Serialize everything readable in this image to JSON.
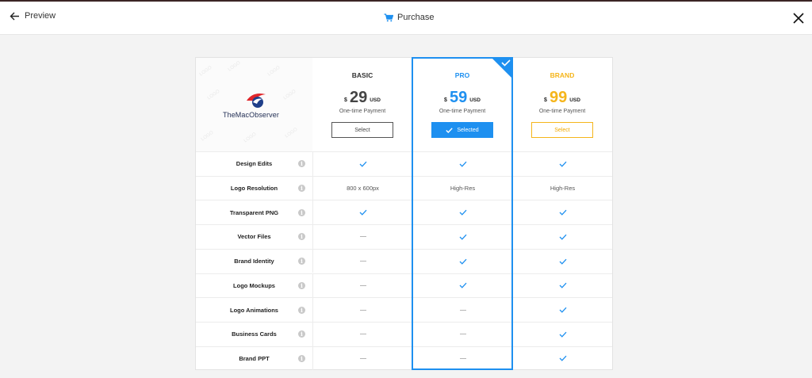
{
  "header": {
    "back_label": "Preview",
    "title": "Purchase"
  },
  "logo": {
    "text": "TheMacObserver"
  },
  "plans": [
    {
      "name": "BASIC",
      "currency": "$",
      "amount": "29",
      "unit": "USD",
      "payment": "One-time Payment",
      "button": "Select",
      "color": "#444444"
    },
    {
      "name": "PRO",
      "currency": "$",
      "amount": "59",
      "unit": "USD",
      "payment": "One-time Payment",
      "button": "Selected",
      "color": "#1e90f0"
    },
    {
      "name": "BRAND",
      "currency": "$",
      "amount": "99",
      "unit": "USD",
      "payment": "One-time Payment",
      "button": "Select",
      "color": "#f5b51b"
    }
  ],
  "features": [
    {
      "name": "Design Edits",
      "values": [
        "check",
        "check",
        "check"
      ]
    },
    {
      "name": "Logo Resolution",
      "values": [
        "800 x 600px",
        "High-Res",
        "High-Res"
      ]
    },
    {
      "name": "Transparent PNG",
      "values": [
        "check",
        "check",
        "check"
      ]
    },
    {
      "name": "Vector Files",
      "values": [
        "dash",
        "check",
        "check"
      ]
    },
    {
      "name": "Brand Identity",
      "values": [
        "dash",
        "check",
        "check"
      ]
    },
    {
      "name": "Logo Mockups",
      "values": [
        "dash",
        "check",
        "check"
      ]
    },
    {
      "name": "Logo Animations",
      "values": [
        "dash",
        "dash",
        "check"
      ]
    },
    {
      "name": "Business Cards",
      "values": [
        "dash",
        "dash",
        "check"
      ]
    },
    {
      "name": "Brand PPT",
      "values": [
        "dash",
        "dash",
        "check"
      ]
    }
  ],
  "colors": {
    "accent": "#1e90f0",
    "brand": "#f5b51b",
    "check": "#1e90f0"
  }
}
